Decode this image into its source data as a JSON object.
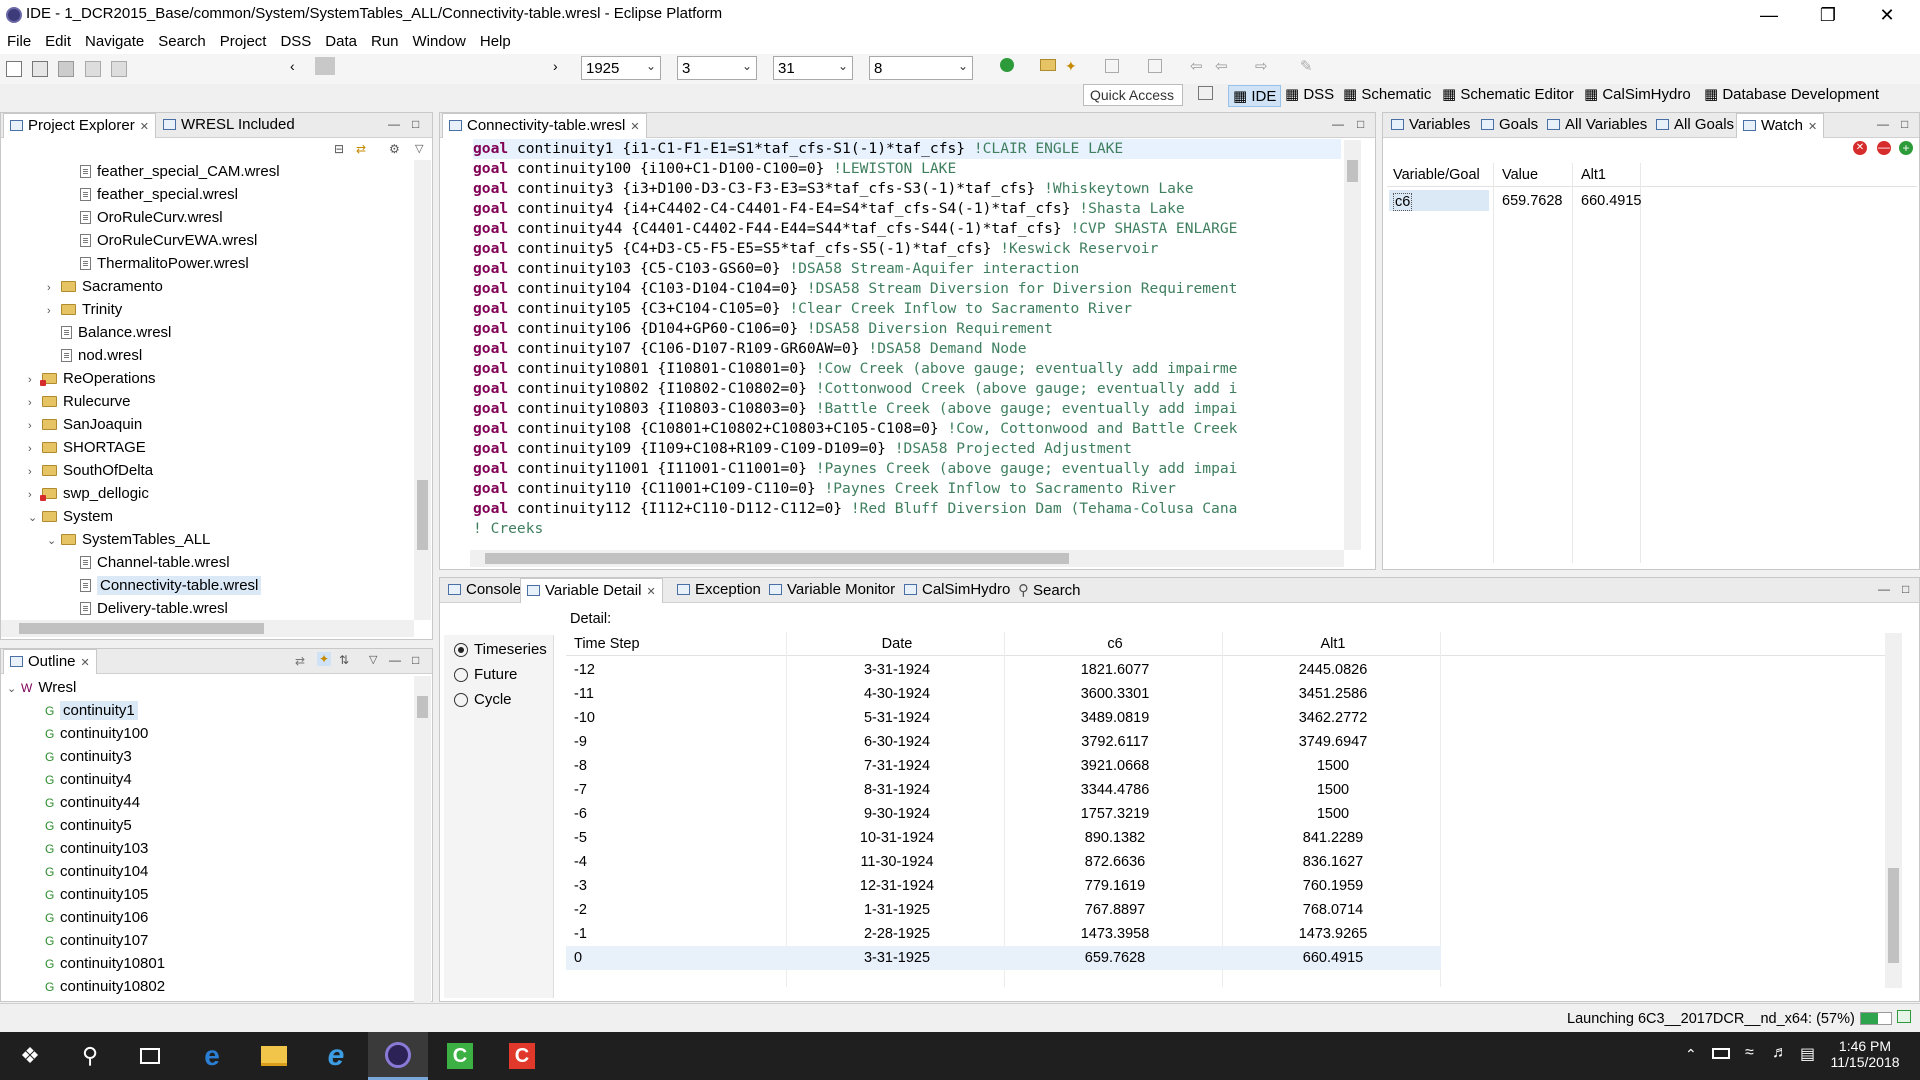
{
  "window": {
    "title": "IDE - 1_DCR2015_Base/common/System/SystemTables_ALL/Connectivity-table.wresl - Eclipse Platform"
  },
  "menu": [
    "File",
    "Edit",
    "Navigate",
    "Search",
    "Project",
    "DSS",
    "Data",
    "Run",
    "Window",
    "Help"
  ],
  "toolbar": {
    "year": "1925",
    "month": "3",
    "day": "31",
    "count": "8",
    "quick_access_placeholder": "Quick Access"
  },
  "perspectives": [
    "IDE",
    "DSS",
    "Schematic",
    "Schematic Editor",
    "CalSimHydro",
    "Database Development"
  ],
  "project_explorer": {
    "tabs": [
      "Project Explorer",
      "WRESL Included"
    ],
    "items": [
      {
        "label": "feather_special_CAM.wresl",
        "type": "file",
        "indent": 3
      },
      {
        "label": "feather_special.wresl",
        "type": "file",
        "indent": 3
      },
      {
        "label": "OroRuleCurv.wresl",
        "type": "file",
        "indent": 3
      },
      {
        "label": "OroRuleCurvEWA.wresl",
        "type": "file",
        "indent": 3
      },
      {
        "label": "ThermalitoPower.wresl",
        "type": "file",
        "indent": 3
      },
      {
        "label": "Sacramento",
        "type": "folder",
        "indent": 2,
        "chev": "›"
      },
      {
        "label": "Trinity",
        "type": "folder",
        "indent": 2,
        "chev": "›"
      },
      {
        "label": "Balance.wresl",
        "type": "file",
        "indent": 2
      },
      {
        "label": "nod.wresl",
        "type": "file",
        "indent": 2
      },
      {
        "label": "ReOperations",
        "type": "folder-err",
        "indent": 1,
        "chev": "›"
      },
      {
        "label": "Rulecurve",
        "type": "folder",
        "indent": 1,
        "chev": "›"
      },
      {
        "label": "SanJoaquin",
        "type": "folder",
        "indent": 1,
        "chev": "›"
      },
      {
        "label": "SHORTAGE",
        "type": "folder",
        "indent": 1,
        "chev": "›"
      },
      {
        "label": "SouthOfDelta",
        "type": "folder",
        "indent": 1,
        "chev": "›"
      },
      {
        "label": "swp_dellogic",
        "type": "folder-err",
        "indent": 1,
        "chev": "›"
      },
      {
        "label": "System",
        "type": "folder",
        "indent": 1,
        "chev": "⌄"
      },
      {
        "label": "SystemTables_ALL",
        "type": "folder",
        "indent": 2,
        "chev": "⌄"
      },
      {
        "label": "Channel-table.wresl",
        "type": "file",
        "indent": 3
      },
      {
        "label": "Connectivity-table.wresl",
        "type": "file",
        "indent": 3,
        "selected": true
      },
      {
        "label": "Delivery-table.wresl",
        "type": "file",
        "indent": 3
      }
    ]
  },
  "outline": {
    "tab": "Outline",
    "root": "Wresl",
    "items": [
      "continuity1",
      "continuity100",
      "continuity3",
      "continuity4",
      "continuity44",
      "continuity5",
      "continuity103",
      "continuity104",
      "continuity105",
      "continuity106",
      "continuity107",
      "continuity10801",
      "continuity10802"
    ]
  },
  "editor": {
    "tab": "Connectivity-table.wresl",
    "lines": [
      {
        "kw": "goal",
        "name": " continuity1 ",
        "expr": "{i1-C1-F1-E1=S1*taf_cfs-S1(-1)*taf_cfs} ",
        "comment": "!CLAIR ENGLE LAKE"
      },
      {
        "kw": "goal",
        "name": " continuity100 ",
        "expr": "{i100+C1-D100-C100=0} ",
        "comment": "!LEWISTON LAKE"
      },
      {
        "kw": "goal",
        "name": " continuity3 ",
        "expr": "{i3+D100-D3-C3-F3-E3=S3*taf_cfs-S3(-1)*taf_cfs} ",
        "comment": "!Whiskeytown Lake"
      },
      {
        "kw": "goal",
        "name": " continuity4 ",
        "expr": "{i4+C4402-C4-C4401-F4-E4=S4*taf_cfs-S4(-1)*taf_cfs} ",
        "comment": "!Shasta Lake"
      },
      {
        "kw": "goal",
        "name": " continuity44 ",
        "expr": "{C4401-C4402-F44-E44=S44*taf_cfs-S44(-1)*taf_cfs} ",
        "comment": "!CVP SHASTA ENLARGE"
      },
      {
        "kw": "goal",
        "name": " continuity5 ",
        "expr": "{C4+D3-C5-F5-E5=S5*taf_cfs-S5(-1)*taf_cfs} ",
        "comment": "!Keswick Reservoir"
      },
      {
        "kw": "goal",
        "name": " continuity103 ",
        "expr": "{C5-C103-GS60=0} ",
        "comment": "!DSA58 Stream-Aquifer interaction"
      },
      {
        "kw": "goal",
        "name": " continuity104 ",
        "expr": "{C103-D104-C104=0} ",
        "comment": "!DSA58 Stream Diversion for Diversion Requirement"
      },
      {
        "kw": "goal",
        "name": " continuity105 ",
        "expr": "{C3+C104-C105=0} ",
        "comment": "!Clear Creek Inflow to Sacramento River"
      },
      {
        "kw": "goal",
        "name": " continuity106 ",
        "expr": "{D104+GP60-C106=0} ",
        "comment": "!DSA58 Diversion Requirement"
      },
      {
        "kw": "goal",
        "name": " continuity107 ",
        "expr": "{C106-D107-R109-GR60AW=0} ",
        "comment": "!DSA58 Demand Node"
      },
      {
        "kw": "goal",
        "name": " continuity10801 ",
        "expr": "{I10801-C10801=0} ",
        "comment": "!Cow Creek (above gauge; eventually add impairme"
      },
      {
        "kw": "goal",
        "name": " continuity10802 ",
        "expr": "{I10802-C10802=0} ",
        "comment": "!Cottonwood Creek (above gauge; eventually add i"
      },
      {
        "kw": "goal",
        "name": " continuity10803 ",
        "expr": "{I10803-C10803=0} ",
        "comment": "!Battle Creek (above gauge; eventually add impai"
      },
      {
        "kw": "goal",
        "name": " continuity108 ",
        "expr": "{C10801+C10802+C10803+C105-C108=0} ",
        "comment": "!Cow, Cottonwood and Battle Creek"
      },
      {
        "kw": "goal",
        "name": " continuity109 ",
        "expr": "{I109+C108+R109-C109-D109=0} ",
        "comment": "!DSA58 Projected Adjustment"
      },
      {
        "kw": "goal",
        "name": " continuity11001 ",
        "expr": "{I11001-C11001=0} ",
        "comment": "!Paynes Creek (above gauge; eventually add impai"
      },
      {
        "kw": "goal",
        "name": " continuity110 ",
        "expr": "{C11001+C109-C110=0} ",
        "comment": "!Paynes Creek Inflow to Sacramento River"
      },
      {
        "kw": "goal",
        "name": " continuity112 ",
        "expr": "{I112+C110-D112-C112=0} ",
        "comment": "!Red Bluff Diversion Dam (Tehama-Colusa Cana"
      },
      {
        "kw": "",
        "name": "",
        "expr": "",
        "comment": "! Creeks"
      }
    ]
  },
  "watch": {
    "tabs": [
      "Variables",
      "Goals",
      "All Variables",
      "All Goals",
      "Watch"
    ],
    "headers": [
      "Variable/Goal",
      "Value",
      "Alt1"
    ],
    "rows": [
      {
        "name": "c6",
        "value": "659.7628",
        "alt": "660.4915"
      }
    ]
  },
  "bottom_tabs": [
    "Console",
    "Variable Detail",
    "Exception",
    "Variable Monitor",
    "CalSimHydro",
    "Search"
  ],
  "detail": {
    "label": "Detail:",
    "radios": [
      "Timeseries",
      "Future",
      "Cycle"
    ],
    "headers": [
      "Time Step",
      "Date",
      "c6",
      "Alt1"
    ],
    "rows": [
      [
        "-12",
        "3-31-1924",
        "1821.6077",
        "2445.0826"
      ],
      [
        "-11",
        "4-30-1924",
        "3600.3301",
        "3451.2586"
      ],
      [
        "-10",
        "5-31-1924",
        "3489.0819",
        "3462.2772"
      ],
      [
        "-9",
        "6-30-1924",
        "3792.6117",
        "3749.6947"
      ],
      [
        "-8",
        "7-31-1924",
        "3921.0668",
        "1500"
      ],
      [
        "-7",
        "8-31-1924",
        "3344.4786",
        "1500"
      ],
      [
        "-6",
        "9-30-1924",
        "1757.3219",
        "1500"
      ],
      [
        "-5",
        "10-31-1924",
        "890.1382",
        "841.2289"
      ],
      [
        "-4",
        "11-30-1924",
        "872.6636",
        "836.1627"
      ],
      [
        "-3",
        "12-31-1924",
        "779.1619",
        "760.1959"
      ],
      [
        "-2",
        "1-31-1925",
        "767.8897",
        "768.0714"
      ],
      [
        "-1",
        "2-28-1925",
        "1473.3958",
        "1473.9265"
      ],
      [
        "0",
        "3-31-1925",
        "659.7628",
        "660.4915"
      ]
    ]
  },
  "status": {
    "text": "Launching 6C3__2017DCR__nd_x64: (57%)",
    "progress": 0.57
  },
  "clock": {
    "time": "1:46 PM",
    "date": "11/15/2018"
  }
}
